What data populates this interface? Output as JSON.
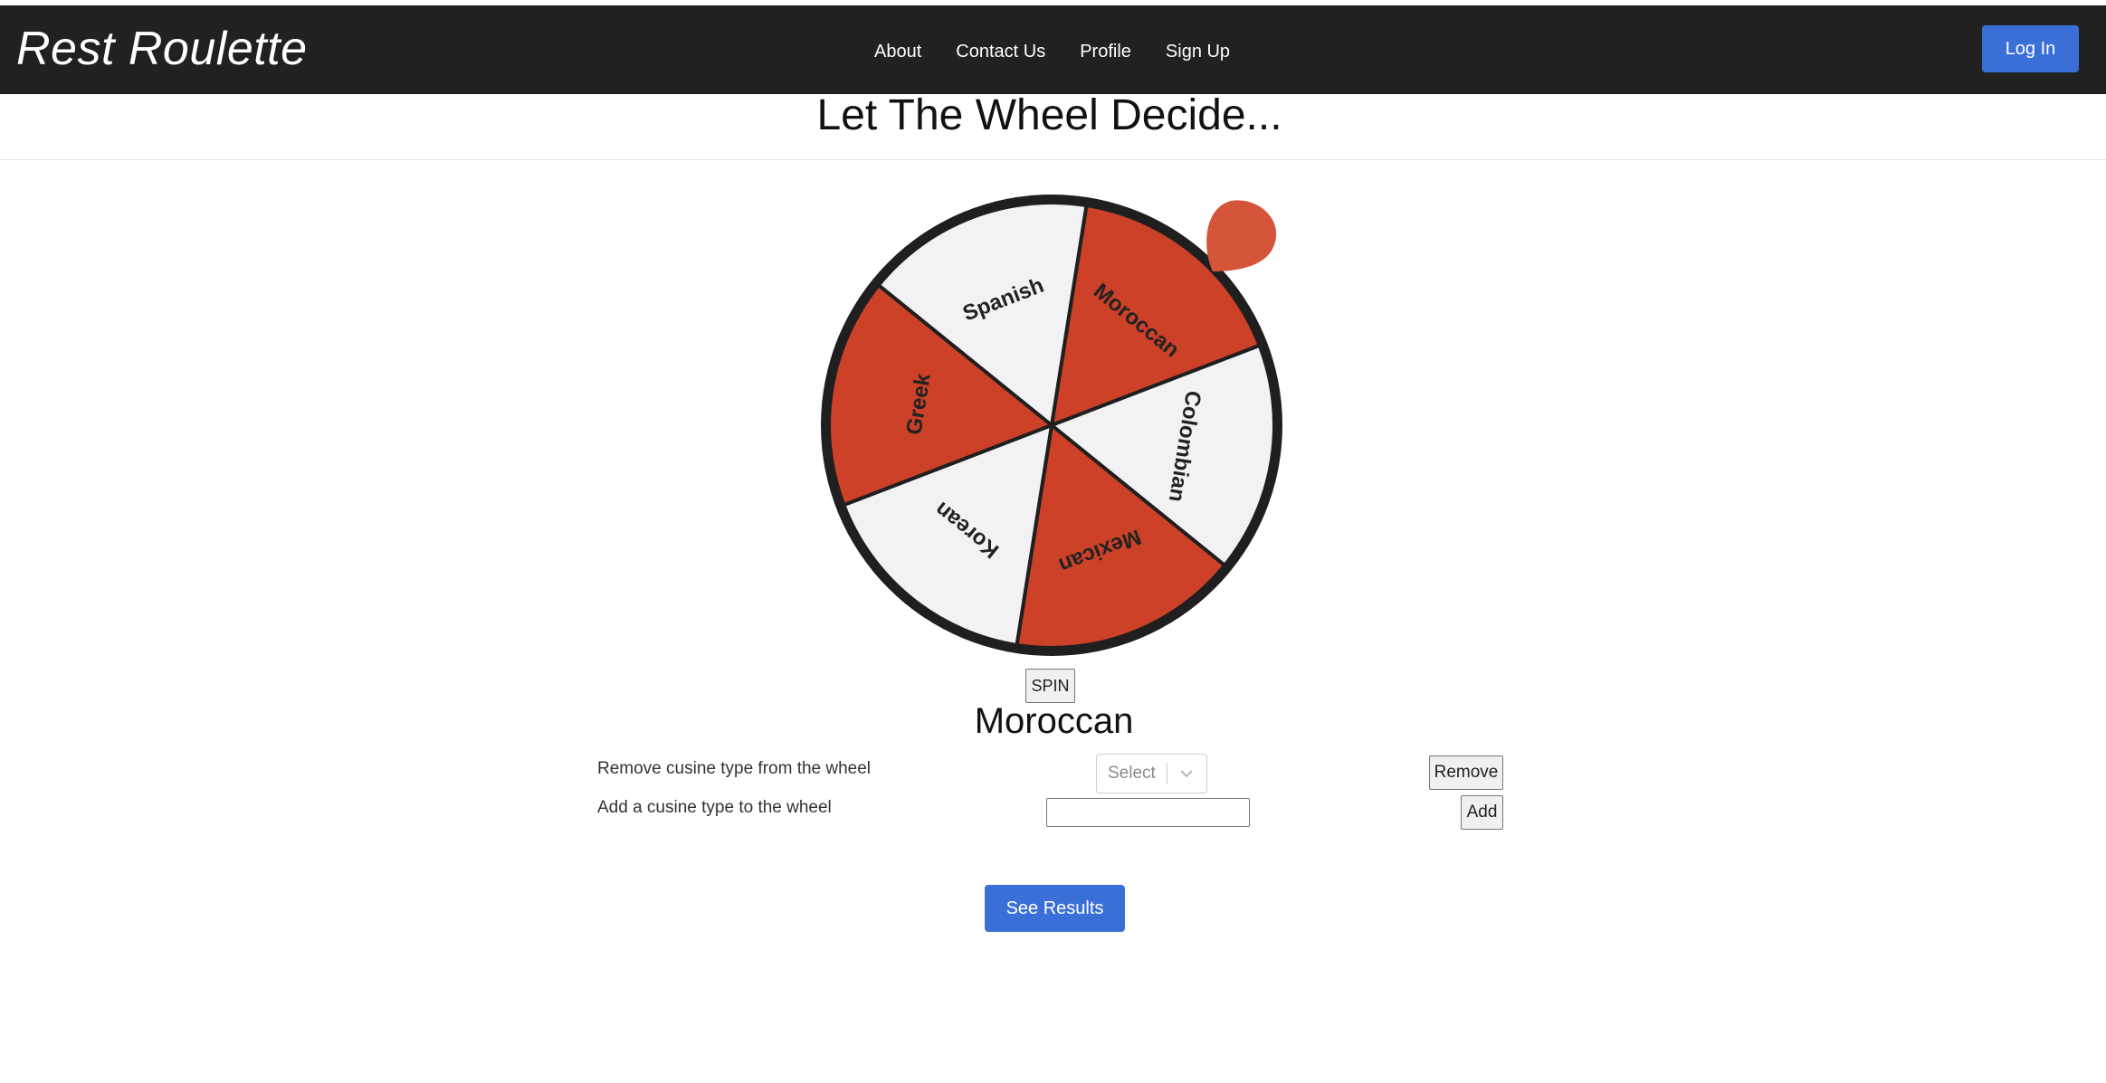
{
  "navbar": {
    "brand": "Rest Roulette",
    "links": [
      "About",
      "Contact Us",
      "Profile",
      "Sign Up"
    ],
    "login_label": "Log In"
  },
  "main": {
    "title": "Let The Wheel Decide...",
    "wheel": {
      "segments": [
        {
          "label": "Moroccan",
          "color": "#cc4128"
        },
        {
          "label": "Colombian",
          "color": "#f2f1f3"
        },
        {
          "label": "Mexican",
          "color": "#cc4128"
        },
        {
          "label": "Korean",
          "color": "#f2f1f3"
        },
        {
          "label": "Greek",
          "color": "#cc4128"
        },
        {
          "label": "Spanish",
          "color": "#f2f1f3"
        }
      ],
      "pointer_color": "#d4553a",
      "rim_color": "#1f1f1f"
    },
    "spin_label": "SPIN",
    "result": "Moroccan",
    "remove_label": "Remove cusine type from the wheel",
    "remove_select_placeholder": "Select",
    "remove_button": "Remove",
    "add_label": "Add a cusine type to the wheel",
    "add_input_value": "",
    "add_button": "Add",
    "see_results": "See Results"
  }
}
